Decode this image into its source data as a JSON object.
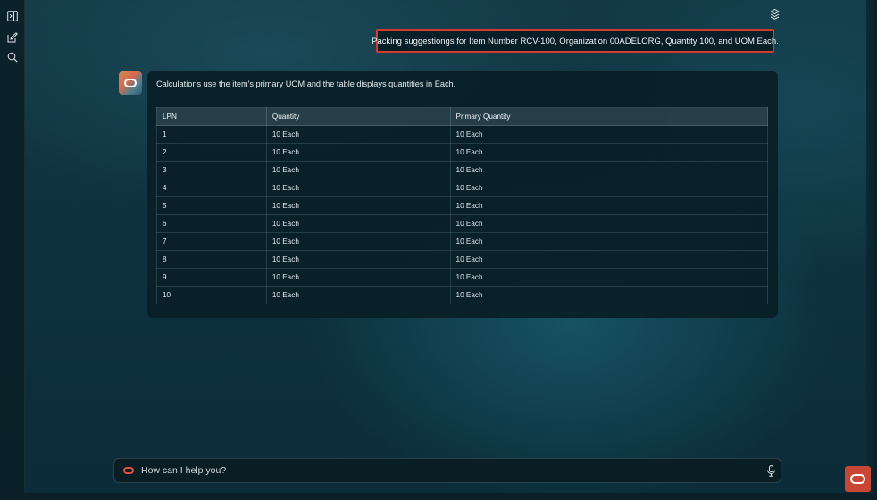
{
  "rail": {
    "items": [
      {
        "name": "collapse-panel",
        "icon": "panel-expand-icon"
      },
      {
        "name": "new-chat",
        "icon": "edit-icon"
      },
      {
        "name": "search",
        "icon": "search-icon"
      }
    ]
  },
  "header": {
    "layers_icon": "layers-icon"
  },
  "conversation": {
    "user_prompt": "Packing suggestiongs for Item Number RCV-100, Organization 00ADELORG, Quantity 100, and UOM Each.",
    "assistant": {
      "intro": "Calculations use the item's primary UOM and the table displays quantities in Each.",
      "table": {
        "columns": [
          "LPN",
          "Quantity",
          "Primary Quantity"
        ],
        "rows": [
          [
            "1",
            "10 Each",
            "10 Each"
          ],
          [
            "2",
            "10 Each",
            "10 Each"
          ],
          [
            "3",
            "10 Each",
            "10 Each"
          ],
          [
            "4",
            "10 Each",
            "10 Each"
          ],
          [
            "5",
            "10 Each",
            "10 Each"
          ],
          [
            "6",
            "10 Each",
            "10 Each"
          ],
          [
            "7",
            "10 Each",
            "10 Each"
          ],
          [
            "8",
            "10 Each",
            "10 Each"
          ],
          [
            "9",
            "10 Each",
            "10 Each"
          ],
          [
            "10",
            "10 Each",
            "10 Each"
          ]
        ]
      }
    }
  },
  "input": {
    "placeholder": "How can I help you?",
    "value": ""
  },
  "colors": {
    "accent": "#c74634",
    "highlight_border": "#d23c2e",
    "background": "#0e3340"
  }
}
